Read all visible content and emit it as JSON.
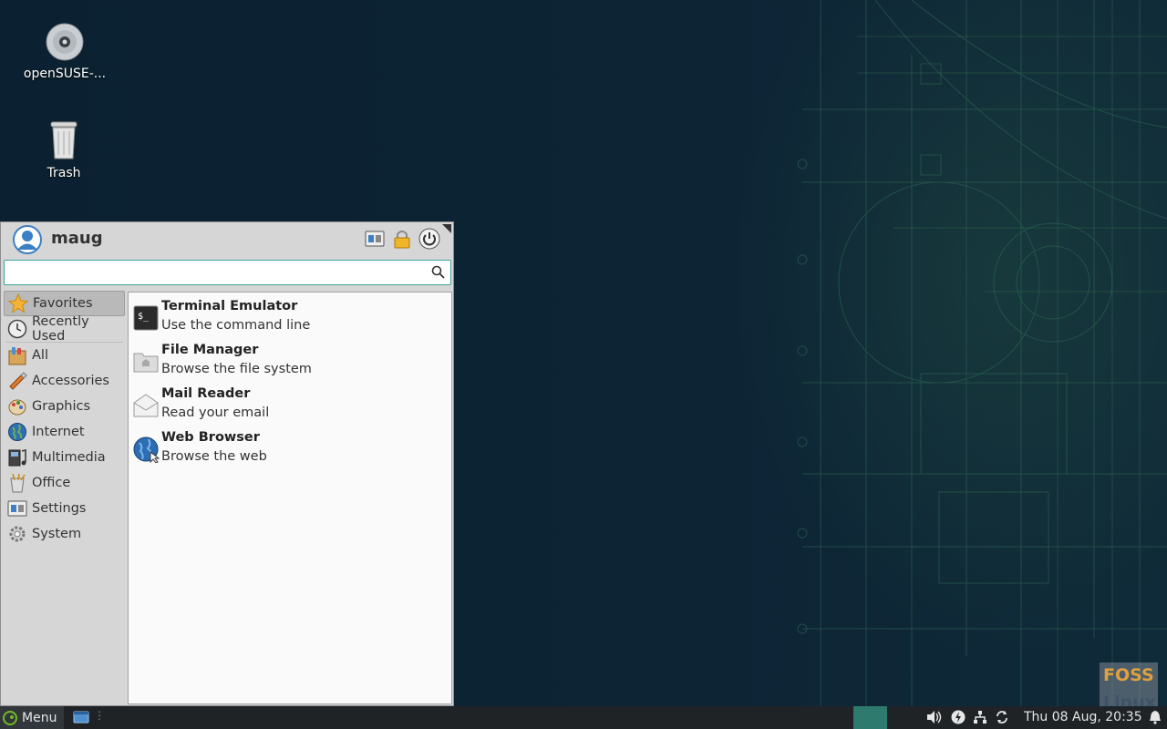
{
  "desktop": {
    "icons": [
      {
        "label": "openSUSE-...",
        "icon": "disc-icon"
      },
      {
        "label": "Trash",
        "icon": "trash-icon"
      }
    ]
  },
  "menu": {
    "username": "maug",
    "search": {
      "value": "",
      "placeholder": ""
    },
    "categories": [
      {
        "label": "Favorites",
        "icon": "star-icon",
        "selected": true
      },
      {
        "label": "Recently Used",
        "icon": "clock-icon"
      },
      {
        "label": "All",
        "icon": "all-apps-icon"
      },
      {
        "label": "Accessories",
        "icon": "accessories-icon"
      },
      {
        "label": "Graphics",
        "icon": "graphics-icon"
      },
      {
        "label": "Internet",
        "icon": "globe-icon"
      },
      {
        "label": "Multimedia",
        "icon": "multimedia-icon"
      },
      {
        "label": "Office",
        "icon": "office-icon"
      },
      {
        "label": "Settings",
        "icon": "settings-icon"
      },
      {
        "label": "System",
        "icon": "gear-icon"
      }
    ],
    "apps": [
      {
        "name": "Terminal Emulator",
        "desc": "Use the command line",
        "icon": "terminal-icon"
      },
      {
        "name": "File Manager",
        "desc": "Browse the file system",
        "icon": "folder-icon"
      },
      {
        "name": "Mail Reader",
        "desc": "Read your email",
        "icon": "mail-icon"
      },
      {
        "name": "Web Browser",
        "desc": "Browse the web",
        "icon": "web-browser-icon"
      }
    ]
  },
  "taskbar": {
    "menu_label": "Menu",
    "clock": "Thu 08 Aug, 20:35"
  },
  "watermark": {
    "line1": "FOSS",
    "line2": "Linux"
  },
  "colors": {
    "desktop_bg": "#0c2233",
    "accent": "#3aa59a",
    "taskbar_bg": "#1f2326",
    "menu_bg": "#d6d6d6"
  }
}
